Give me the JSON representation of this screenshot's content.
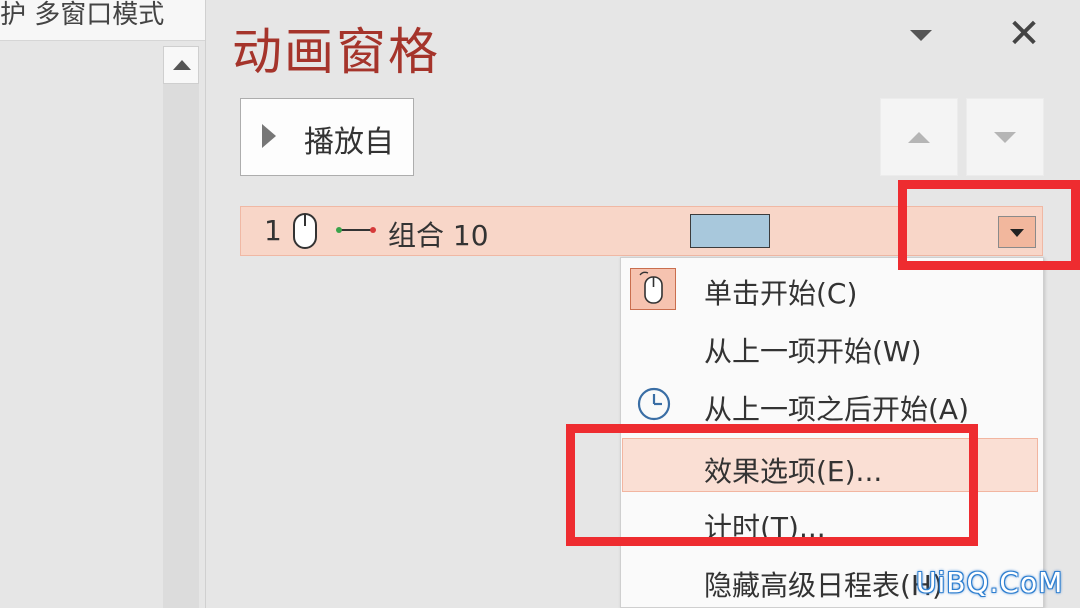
{
  "left_panel": {
    "top_text": "护 多窗口模式"
  },
  "pane": {
    "title": "动画窗格",
    "play_button_label": "播放自"
  },
  "animation_item": {
    "index": "1",
    "label": "组合 10"
  },
  "context_menu": {
    "items": [
      {
        "label": "单击开始(C)"
      },
      {
        "label": "从上一项开始(W)"
      },
      {
        "label": "从上一项之后开始(A)"
      },
      {
        "label": "效果选项(E)..."
      },
      {
        "label": "计时(T)..."
      },
      {
        "label": "隐藏高级日程表(H)"
      }
    ]
  },
  "watermark": "UiBQ.CoM",
  "colors": {
    "title": "#a5342b",
    "highlight_red": "#ee2c30",
    "row_bg": "#f8d6c8",
    "timeline_bar": "#a8c8dc"
  }
}
